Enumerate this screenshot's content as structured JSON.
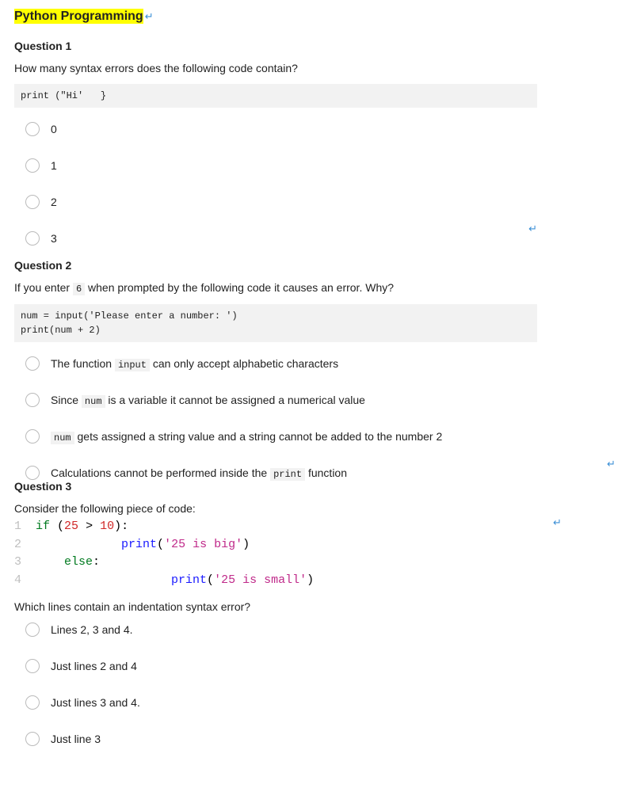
{
  "title": "Python Programming",
  "q1": {
    "heading": "Question 1",
    "prompt": "How many syntax errors does the following code contain?",
    "code": "print (\"Hi'   }",
    "options": [
      "0",
      "1",
      "2",
      "3"
    ]
  },
  "q2": {
    "heading": "Question 2",
    "prompt_pre": "If you enter ",
    "prompt_code": "6",
    "prompt_post": " when prompted by the following code it causes an error. Why?",
    "code": "num = input('Please enter a number: ')\nprint(num + 2)",
    "opt0_pre": "The function ",
    "opt0_code": "input",
    "opt0_post": " can only accept alphabetic characters",
    "opt1_pre": "Since ",
    "opt1_code": "num",
    "opt1_post": " is a variable it cannot be assigned a numerical value",
    "opt2_code": "num",
    "opt2_post": " gets assigned a string value and a string cannot be added to the number 2",
    "opt3_pre": "Calculations cannot be performed inside the ",
    "opt3_code": "print",
    "opt3_post": " function"
  },
  "q3": {
    "heading": "Question 3",
    "prompt": "Consider the following piece of code:",
    "line1_ln": "1",
    "line1_kw": "if",
    "line1_paren_open": " (",
    "line1_num1": "25",
    "line1_gt": " > ",
    "line1_num2": "10",
    "line1_paren_close": "):",
    "line2_ln": "2",
    "line2_pad": "             ",
    "line2_fn": "print",
    "line2_po": "(",
    "line2_str": "'25 is big'",
    "line2_pc": ")",
    "line3_ln": "3",
    "line3_pad": "     ",
    "line3_kw": "else",
    "line3_colon": ":",
    "line4_ln": "4",
    "line4_pad": "                    ",
    "line4_fn": "print",
    "line4_po": "(",
    "line4_str": "'25 is small'",
    "line4_pc": ")",
    "prompt2": "Which lines contain an indentation syntax error?",
    "options": [
      "Lines 2, 3 and 4.",
      "Just lines 2 and 4",
      "Just lines 3 and 4.",
      "Just line 3"
    ]
  },
  "glyphs": {
    "return": "↵"
  }
}
